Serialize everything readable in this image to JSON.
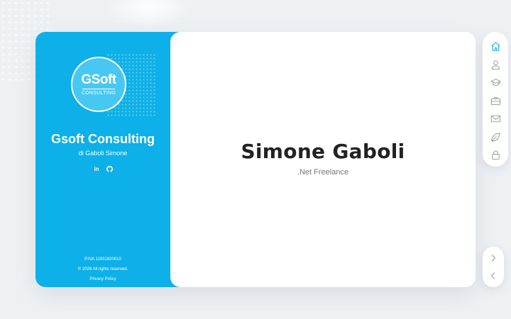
{
  "logo": {
    "main": "GSoft",
    "sub": "CONSULTING"
  },
  "sidebar": {
    "company_name": "Gsoft Consulting",
    "company_sub": "di Gaboli Simone",
    "social": [
      {
        "icon": "linkedin-icon",
        "label": "in"
      },
      {
        "icon": "github-icon",
        "label": ""
      }
    ],
    "footer": {
      "vat": "P.IVA 11931820010",
      "copyright": "© 2026 All rights reserved.",
      "privacy": "Privacy Policy"
    }
  },
  "main": {
    "name": "Simone Gaboli",
    "role": ".Net Freelance"
  },
  "nav": {
    "items": [
      {
        "icon": "home-icon",
        "active": true
      },
      {
        "icon": "user-icon",
        "active": false
      },
      {
        "icon": "graduation-cap-icon",
        "active": false
      },
      {
        "icon": "briefcase-icon",
        "active": false
      },
      {
        "icon": "envelope-icon",
        "active": false
      },
      {
        "icon": "leaf-icon",
        "active": false
      },
      {
        "icon": "lock-icon",
        "active": false
      }
    ]
  },
  "arrows": [
    {
      "icon": "chevron-right-icon"
    },
    {
      "icon": "chevron-left-icon"
    }
  ],
  "colors": {
    "accent": "#0db0e8",
    "active_icon": "#0db0e8",
    "icon": "#9aa0a6",
    "background": "#eef1f4"
  }
}
